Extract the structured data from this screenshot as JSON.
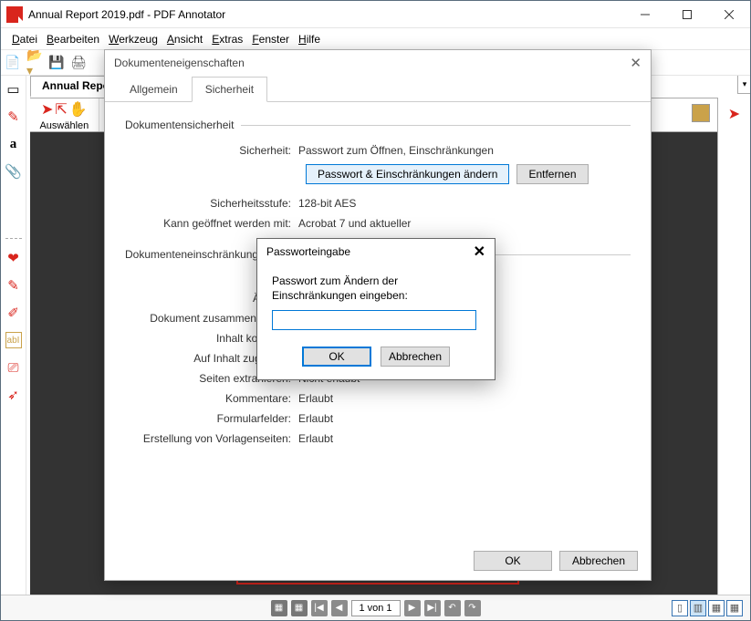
{
  "window": {
    "title": "Annual Report 2019.pdf - PDF Annotator"
  },
  "menubar": [
    "Datei",
    "Bearbeiten",
    "Werkzeug",
    "Ansicht",
    "Extras",
    "Fenster",
    "Hilfe"
  ],
  "doc_tab": "Annual Report",
  "select_label": "Auswählen",
  "pager": {
    "value": "1 von 1"
  },
  "properties_dialog": {
    "title": "Dokumenteneigenschaften",
    "tabs": {
      "general": "Allgemein",
      "security": "Sicherheit"
    },
    "section_security": "Dokumentensicherheit",
    "rows_security": {
      "security_k": "Sicherheit:",
      "security_v": "Passwort zum Öffnen, Einschränkungen",
      "level_k": "Sicherheitsstufe:",
      "level_v": "128-bit AES",
      "open_with_k": "Kann geöffnet werden mit:",
      "open_with_v": "Acrobat 7 und aktueller"
    },
    "btn_change": "Passwort & Einschränkungen ändern",
    "btn_remove": "Entfernen",
    "section_restrictions": "Dokumenteneinschränkungen",
    "rows_restrictions": [
      {
        "k": "Ändern:",
        "v": ""
      },
      {
        "k": "Dokument zusammenstellen:",
        "v": ""
      },
      {
        "k": "Inhalt kopieren:",
        "v": ""
      },
      {
        "k": "Auf Inhalt zugreifen:",
        "v": ""
      },
      {
        "k": "Seiten extrahieren:",
        "v": "Nicht erlaubt"
      },
      {
        "k": "Kommentare:",
        "v": "Erlaubt"
      },
      {
        "k": "Formularfelder:",
        "v": "Erlaubt"
      },
      {
        "k": "Erstellung von Vorlagenseiten:",
        "v": "Erlaubt"
      }
    ],
    "ok": "OK",
    "cancel": "Abbrechen"
  },
  "password_dialog": {
    "title": "Passworteingabe",
    "message": "Passwort zum Ändern der Einschränkungen eingeben:",
    "ok": "OK",
    "cancel": "Abbrechen"
  }
}
